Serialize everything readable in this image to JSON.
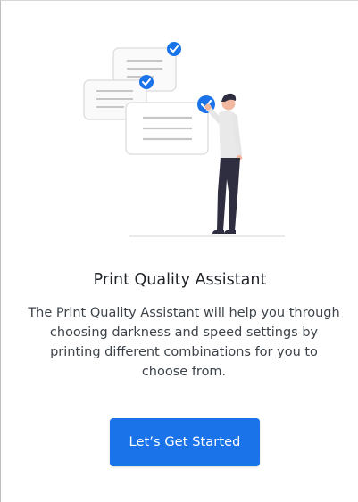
{
  "dialog": {
    "title": "Print Quality Assistant",
    "description": "The Print Quality Assistant will help you through choosing darkness and speed settings by printing different combinations for you to choose from.",
    "primary_button_label": "Let’s Get Started"
  },
  "colors": {
    "accent": "#1a73e8",
    "text_primary": "#1f2328",
    "text_secondary": "#3d434a",
    "card_fill": "#fafafa",
    "card_border": "#d9d9d9"
  },
  "illustration": {
    "icons": [
      "document-card-icon",
      "checkmark-icon",
      "person-figure"
    ],
    "checked_cards": 3
  }
}
